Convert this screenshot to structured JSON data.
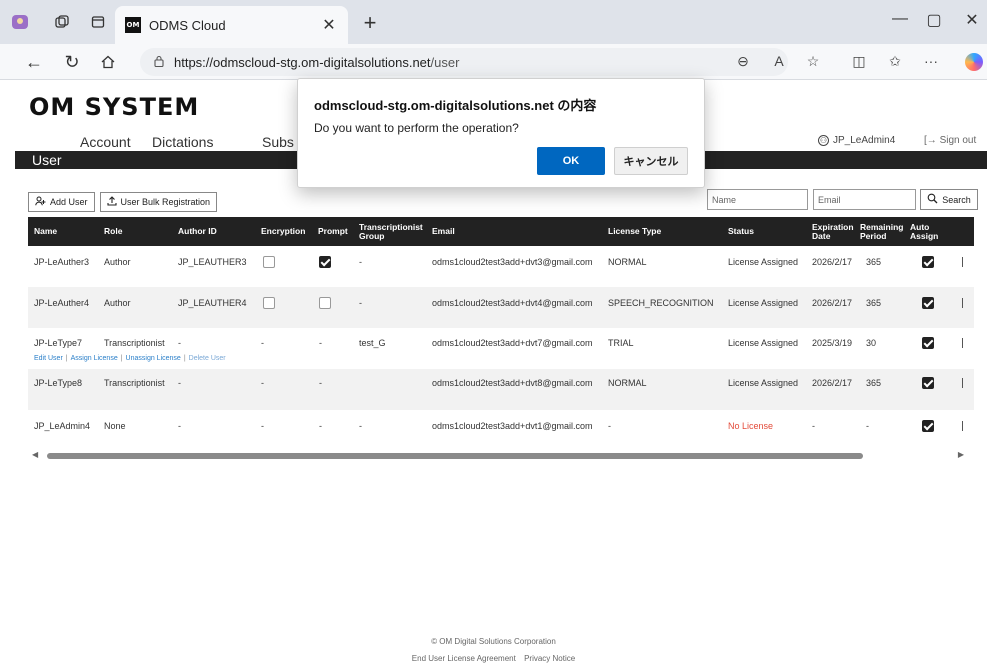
{
  "browser": {
    "tab_title": "ODMS Cloud",
    "favicon_text": "OM",
    "url_host": "https://odmscloud-stg.om-digitalsolutions.net",
    "url_path": "/user"
  },
  "page": {
    "logo": "OM SYSTEM",
    "nav": [
      "Account",
      "Dictations",
      "Subs"
    ],
    "user_label": "JP_LeAdmin4",
    "signout_label": "Sign out",
    "title": "User",
    "add_user_label": "Add User",
    "bulk_label": "User Bulk Registration",
    "name_placeholder": "Name",
    "email_placeholder": "Email",
    "search_label": "Search"
  },
  "table": {
    "headers": [
      "Name",
      "Role",
      "Author ID",
      "Encryption",
      "Prompt",
      "Transcriptionist Group",
      "Email",
      "License Type",
      "Status",
      "Expiration Date",
      "Remaining Period",
      "Auto Assign"
    ],
    "rows": [
      {
        "name": "JP-LeAuther3",
        "role": "Author",
        "author_id": "JP_LEAUTHER3",
        "encryption": "box-off",
        "prompt": "box-on",
        "group": "-",
        "email": "odms1cloud2test3add+dvt3@gmail.com",
        "license": "NORMAL",
        "status": "License Assigned",
        "expiration": "2026/2/17",
        "remaining": "365",
        "auto": true
      },
      {
        "name": "JP-LeAuther4",
        "role": "Author",
        "author_id": "JP_LEAUTHER4",
        "encryption": "box-off",
        "prompt": "box-off",
        "group": "-",
        "email": "odms1cloud2test3add+dvt4@gmail.com",
        "license": "SPEECH_RECOGNITION",
        "status": "License Assigned",
        "expiration": "2026/2/17",
        "remaining": "365",
        "auto": true
      },
      {
        "name": "JP-LeType7",
        "role": "Transcriptionist",
        "author_id": "-",
        "encryption": "-",
        "prompt": "-",
        "group": "test_G",
        "email": "odms1cloud2test3add+dvt7@gmail.com",
        "license": "TRIAL",
        "status": "License Assigned",
        "expiration": "2025/3/19",
        "remaining": "30",
        "auto": true
      },
      {
        "name": "JP-LeType8",
        "role": "Transcriptionist",
        "author_id": "-",
        "encryption": "-",
        "prompt": "-",
        "group": "",
        "email": "odms1cloud2test3add+dvt8@gmail.com",
        "license": "NORMAL",
        "status": "License Assigned",
        "expiration": "2026/2/17",
        "remaining": "365",
        "auto": true
      },
      {
        "name": "JP_LeAdmin4",
        "role": "None",
        "author_id": "-",
        "encryption": "-",
        "prompt": "-",
        "group": "-",
        "email": "odms1cloud2test3add+dvt1@gmail.com",
        "license": "-",
        "status": "No License",
        "expiration": "-",
        "remaining": "-",
        "auto": true
      }
    ],
    "row_actions": [
      "Edit User",
      "Assign License",
      "Unassign License",
      "Delete User"
    ]
  },
  "footer": {
    "copyright": "© OM Digital Solutions Corporation",
    "eula": "End User License Agreement",
    "privacy": "Privacy Notice"
  },
  "dialog": {
    "title": "odmscloud-stg.om-digitalsolutions.net の内容",
    "message": "Do you want to perform the operation?",
    "ok": "OK",
    "cancel": "キャンセル"
  }
}
